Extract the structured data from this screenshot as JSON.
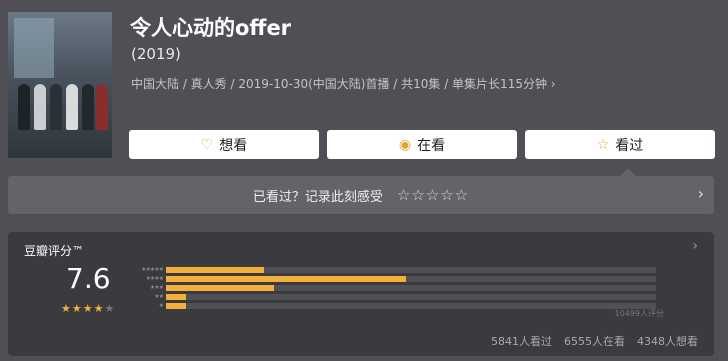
{
  "header": {
    "title": "令人心动的offer",
    "year": "(2019)",
    "meta": "中国大陆 / 真人秀 / 2019-10-30(中国大陆)首播 / 共10集 / 单集片长115分钟 ›"
  },
  "actions": {
    "want": {
      "icon": "heart-plus-icon",
      "label": "想看"
    },
    "watching": {
      "icon": "circle-dot-icon",
      "label": "在看"
    },
    "watched": {
      "icon": "star-icon",
      "label": "看过"
    }
  },
  "rate_prompt": {
    "text": "已看过？记录此刻感受",
    "stars": "☆☆☆☆☆"
  },
  "rating": {
    "title": "豆瓣评分™",
    "score": "7.6",
    "stars_filled": 4,
    "distribution": [
      {
        "stars": "★★★★★",
        "fraction": 0.2
      },
      {
        "stars": "★★★★",
        "fraction": 0.49
      },
      {
        "stars": "★★★",
        "fraction": 0.22
      },
      {
        "stars": "★★",
        "fraction": 0.04
      },
      {
        "stars": "★",
        "fraction": 0.04
      }
    ],
    "count": "10499人评分",
    "stats": [
      "5841人看过",
      "6555人在看",
      "4348人想看"
    ]
  },
  "colors": {
    "accent": "#f2b03a",
    "bg": "#4f4f55",
    "panel": "#3a3a3f"
  }
}
